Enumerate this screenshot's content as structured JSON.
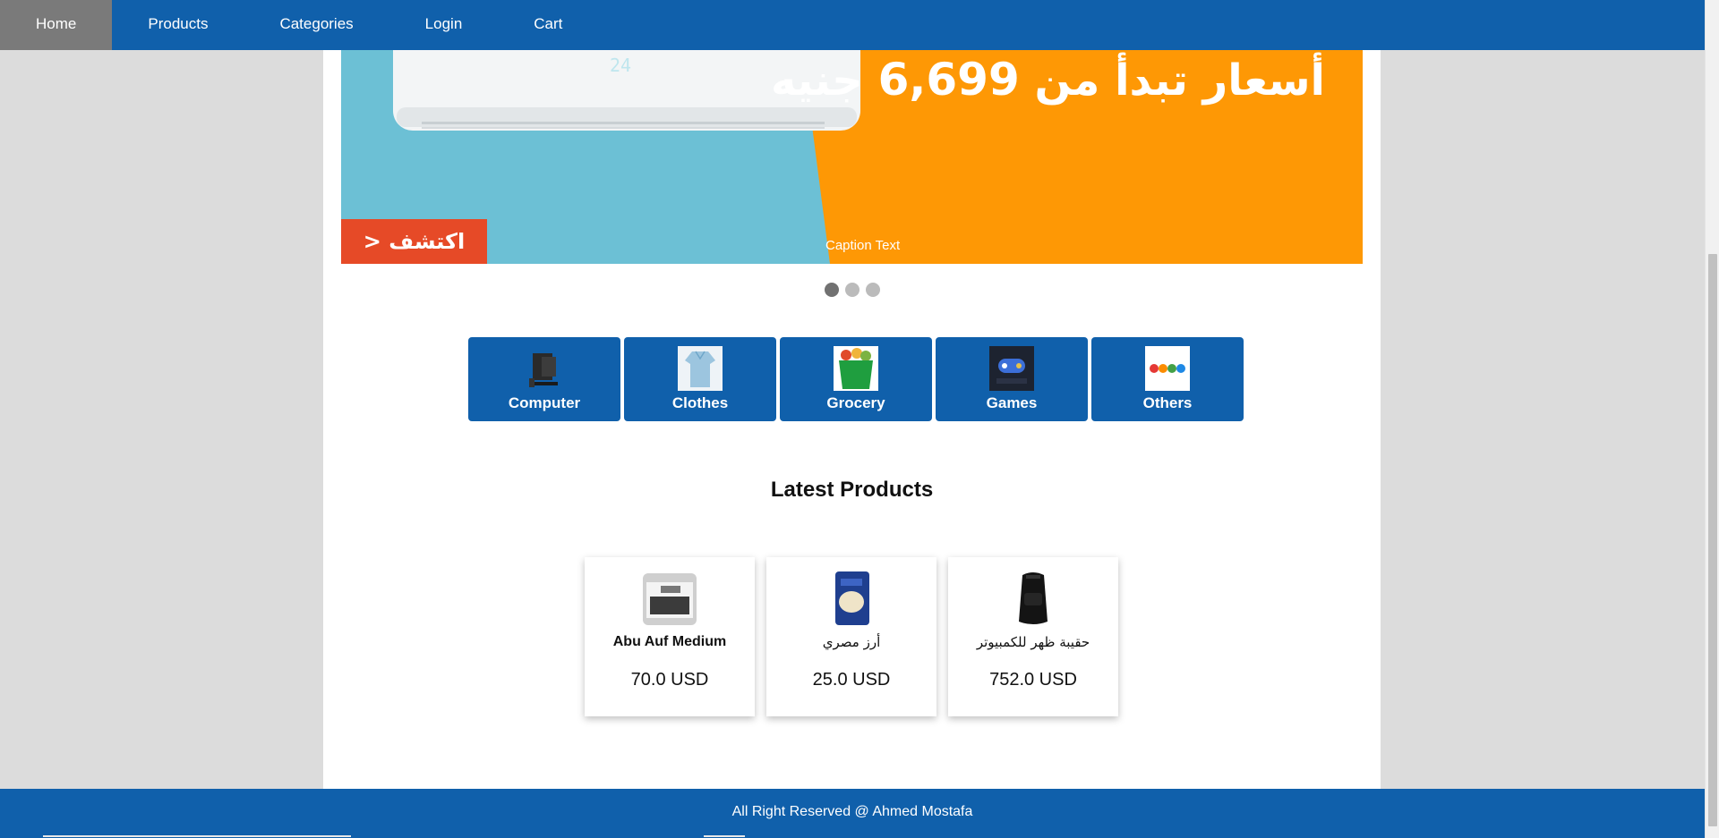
{
  "nav": {
    "items": [
      {
        "label": "Home",
        "active": true
      },
      {
        "label": "Products",
        "active": false
      },
      {
        "label": "Categories",
        "active": false
      },
      {
        "label": "Login",
        "active": false
      },
      {
        "label": "Cart",
        "active": false
      }
    ]
  },
  "slider": {
    "promo_text": "أسعار تبدأ من",
    "promo_price": "6,699",
    "promo_currency": "جنيه",
    "cta_label": "اكتشف <",
    "display_digits": "24",
    "caption": "Caption Text",
    "dots": [
      true,
      false,
      false
    ]
  },
  "categories": [
    {
      "label": "Computer",
      "icon": "computer-icon"
    },
    {
      "label": "Clothes",
      "icon": "clothes-icon"
    },
    {
      "label": "Grocery",
      "icon": "grocery-icon"
    },
    {
      "label": "Games",
      "icon": "games-icon"
    },
    {
      "label": "Others",
      "icon": "others-icon"
    }
  ],
  "latest": {
    "title": "Latest Products",
    "products": [
      {
        "name": "Abu Auf Medium",
        "price": "70.0 USD"
      },
      {
        "name": "أرز مصري",
        "price": "25.0 USD"
      },
      {
        "name": "حقيبة ظهر للكمبيوتر",
        "price": "752.0 USD"
      }
    ]
  },
  "footer": {
    "text": "All Right Reserved @ Ahmed Mostafa"
  },
  "colors": {
    "brand": "#1060ab",
    "nav_active": "#7a7a7a",
    "slide_blue": "#6cc0d5",
    "slide_orange": "#fe9805",
    "cta_red": "#e64a27"
  }
}
